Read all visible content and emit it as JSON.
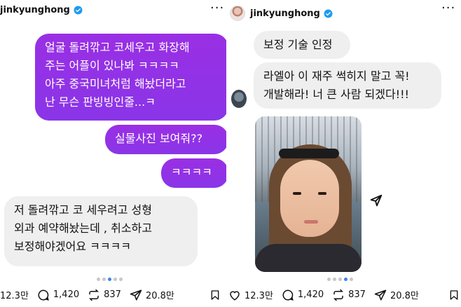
{
  "left_post": {
    "username": "jinkyunghong",
    "messages": [
      {
        "text": "얼굴 돌려깎고 코세우고 화장해\n주는 어플이 있나봐 ㅋㅋㅋㅋ\n아주 중국미녀처럼 해놨더라고\n난 무슨 판빙빙인줄...ㅋ",
        "sender": "self"
      },
      {
        "text": "실물사진 보여줘??",
        "sender": "self"
      },
      {
        "text": "ㅋㅋㅋㅋ",
        "sender": "self"
      },
      {
        "text": "저 돌려깎고 코 세우려고 성형\n외과 예약해놨는데 , 취소하고\n보정해야겠어요 ㅋㅋㅋㅋ",
        "sender": "other"
      }
    ],
    "stats": {
      "likes": "12.3만",
      "comments": "1,420",
      "reposts": "837",
      "shares": "20.8만"
    }
  },
  "right_post": {
    "username": "jinkyunghong",
    "messages": [
      {
        "text": "보정 기술 인정",
        "sender": "other"
      },
      {
        "text": "라엘아 이 재주 썩히지 말고 꼭!\n개발해라! 너 큰 사람 되겠다!!!",
        "sender": "other"
      }
    ],
    "stats": {
      "likes": "12.3만",
      "comments": "1,420",
      "reposts": "837",
      "shares": "20.8만"
    }
  },
  "icons": [
    "verified-badge-icon",
    "more-dots-icon",
    "send-icon",
    "heart-icon",
    "comment-icon",
    "repost-icon",
    "share-icon",
    "bookmark-icon"
  ],
  "colors": {
    "accent_purple": "#8a35e8",
    "bubble_grey": "#efefef",
    "verified_blue": "#1d9bf0",
    "pager_active": "#3b82f6"
  }
}
